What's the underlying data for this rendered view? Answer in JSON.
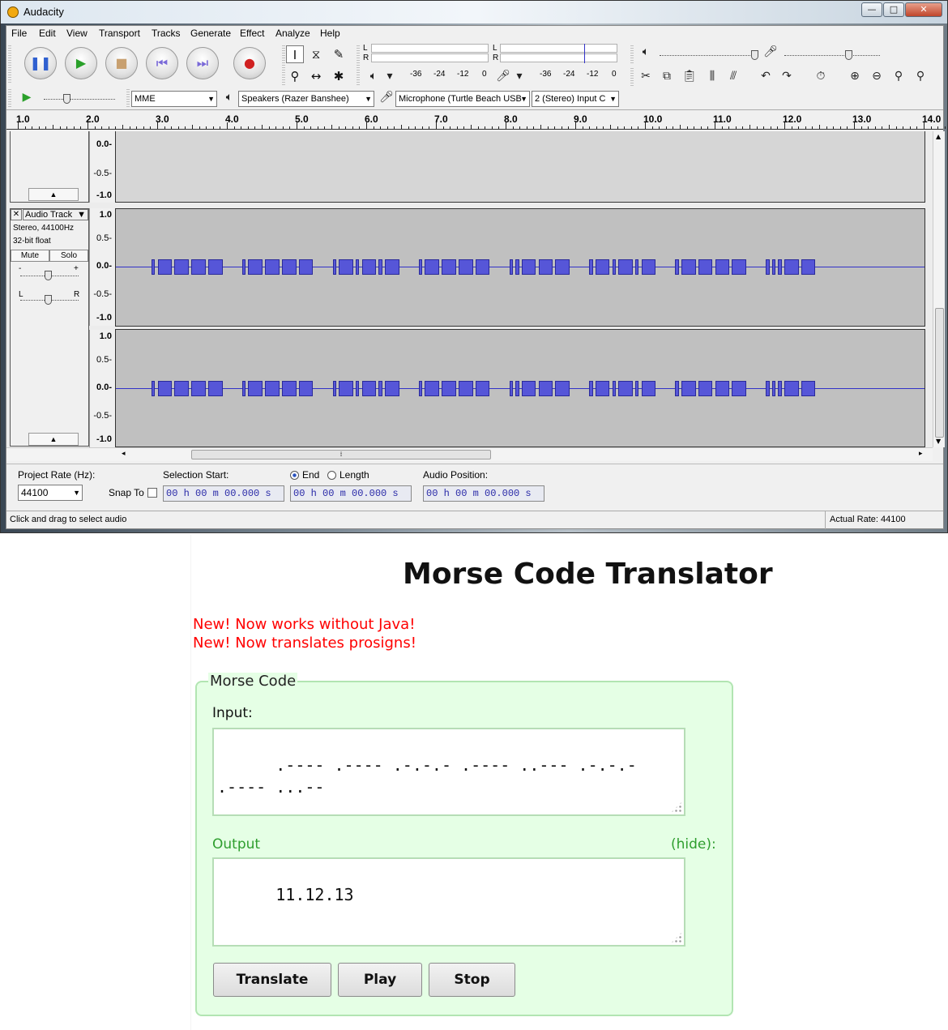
{
  "audacity": {
    "window_title": "Audacity",
    "window_buttons": {
      "minimize": "—",
      "maximize": "□",
      "close": "✕"
    },
    "menu": [
      "File",
      "Edit",
      "View",
      "Transport",
      "Tracks",
      "Generate",
      "Effect",
      "Analyze",
      "Help"
    ],
    "meter": {
      "left": "L",
      "right": "R",
      "playback_ticks": [
        "-36",
        "-24",
        "-12",
        "0"
      ],
      "record_ticks": [
        "-36",
        "-24",
        "-12",
        "0"
      ]
    },
    "device": {
      "host": "MME",
      "output": "Speakers (Razer Banshee)",
      "input": "Microphone (Turtle Beach USB",
      "channels": "2 (Stereo) Input C"
    },
    "ruler": [
      "1.0",
      "2.0",
      "3.0",
      "4.0",
      "5.0",
      "6.0",
      "7.0",
      "8.0",
      "9.0",
      "10.0",
      "11.0",
      "12.0",
      "13.0",
      "14.0"
    ],
    "track_above": {
      "scale": [
        "0.0-",
        "-0.5-",
        "-1.0"
      ]
    },
    "track": {
      "close": "✕",
      "name": "Audio Track",
      "format": "Stereo, 44100Hz",
      "bit_depth": "32-bit float",
      "mute": "Mute",
      "solo": "Solo",
      "gain_minus": "-",
      "gain_plus": "+",
      "pan_left": "L",
      "pan_right": "R",
      "scale": [
        "1.0",
        "0.5-",
        "0.0-",
        "-0.5-",
        "-1.0"
      ],
      "morse_groups": [
        ".----",
        ".----",
        ".-.-.-",
        ".----",
        "..---",
        ".-.-.-",
        ".----",
        "...--"
      ]
    },
    "selection": {
      "project_rate_label": "Project Rate (Hz):",
      "project_rate": "44100",
      "snap_to_label": "Snap To",
      "selection_start_label": "Selection Start:",
      "end_label": "End",
      "length_label": "Length",
      "audio_position_label": "Audio Position:",
      "start_time": "00 h 00 m 00.000 s",
      "end_time": "00 h 00 m 00.000 s",
      "position_time": "00 h 00 m 00.000 s"
    },
    "status": {
      "left": "Click and drag to select audio",
      "right": "Actual Rate: 44100"
    }
  },
  "translator": {
    "title": "Morse Code Translator",
    "news": [
      "New! Now works without Java!",
      "New! Now translates prosigns!"
    ],
    "legend": "Morse Code",
    "input_label": "Input:",
    "input_value": ".---- .---- .-.-.- .---- ..--- .-.-.-\n.---- ...--",
    "output_label": "Output",
    "hide_label": "(hide):",
    "output_value": "11.12.13",
    "buttons": {
      "translate": "Translate",
      "play": "Play",
      "stop": "Stop"
    },
    "colors": {
      "news": "#ff0000",
      "output_label": "#2e9e2e",
      "panel_bg": "#e5ffe5"
    }
  }
}
